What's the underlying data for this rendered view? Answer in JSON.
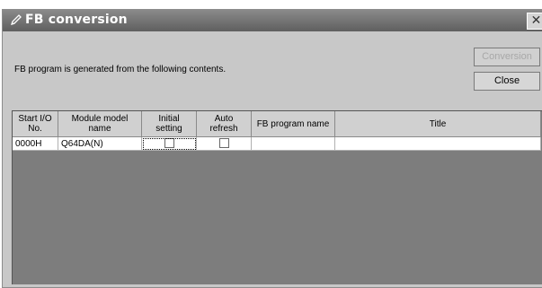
{
  "window": {
    "title": "FB conversion",
    "close_glyph": "✕"
  },
  "message": "FB program is generated from the following contents.",
  "buttons": {
    "conversion": "Conversion",
    "close": "Close"
  },
  "table": {
    "headers": {
      "start_io_line1": "Start I/O",
      "start_io_line2": "No.",
      "module_line1": "Module model",
      "module_line2": "name",
      "initial_line1": "Initial",
      "initial_line2": "setting",
      "auto_line1": "Auto",
      "auto_line2": "refresh",
      "fb_program": "FB program name",
      "title": "Title"
    },
    "rows": [
      {
        "start_io": "0000H",
        "module": "Q64DA(N)",
        "initial_setting": false,
        "auto_refresh": false,
        "fb_program_name": "",
        "title": ""
      }
    ]
  },
  "icons": {
    "title_icon": "pen-icon"
  }
}
